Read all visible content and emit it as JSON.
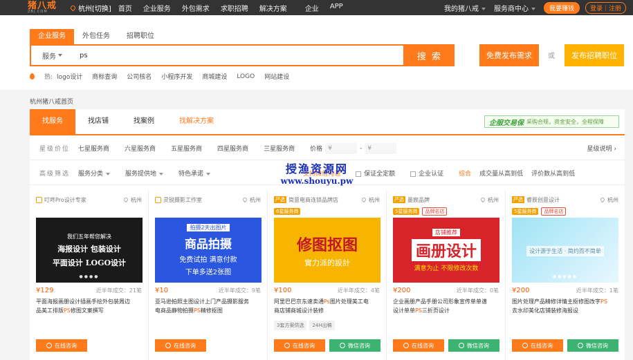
{
  "topbar": {
    "logo": "猪八戒",
    "logo_en": "ZBJ.COM",
    "city": "杭州[切换]",
    "nav": [
      "首页",
      "企业服务",
      "外包需求",
      "求职招聘",
      "解决方案",
      "企业",
      "APP"
    ],
    "my": "我的猪八戒",
    "svc": "服务商中心",
    "earn": "我要赚钱",
    "login": "登录｜注册"
  },
  "search": {
    "tabs": [
      "企业服务",
      "外包任务",
      "招聘职位"
    ],
    "type": "服务",
    "value": "ps",
    "btn": "搜 索",
    "free": "免费发布需求",
    "or": "或",
    "job": "发布招聘职位"
  },
  "hot": {
    "label": "热:",
    "items": [
      "logo设计",
      "商标查询",
      "公司核名",
      "小程序开发",
      "商城建设",
      "LOGO",
      "网站建设"
    ]
  },
  "crumb": "杭州猪八戒首页",
  "ptabs": [
    "找服务",
    "找店铺",
    "找案例",
    "找解决方案"
  ],
  "guar": {
    "name": "企服交易保",
    "desc": "采购合规，资金安全，全程保障"
  },
  "level": {
    "label": "星级价位",
    "items": [
      "七星服务商",
      "六星服务商",
      "五星服务商",
      "四星服务商",
      "三星服务商"
    ],
    "price": "价格",
    "p1": "¥",
    "p2": "¥",
    "dash": "-",
    "right": "星级说明 ›"
  },
  "filter": {
    "label": "高级筛选",
    "items": [
      "服务分类",
      "服务提供地",
      "特色承诺"
    ],
    "trial": "支持微信沟通",
    "c1": "保证全定额",
    "c2": "企业认证",
    "sort": [
      "综合",
      "成交量从高到低",
      "评价数从高到低"
    ]
  },
  "watermark": {
    "l1": "授渔资源网",
    "l2": "www.shouyu.pw"
  },
  "cards": [
    {
      "shop": "叮咚Pro设计专家",
      "badge": "",
      "loc": "杭州",
      "tag1": "",
      "tag2": "",
      "img_top": "我们五年帮您解决",
      "img_l1": "海报设计 包装设计",
      "img_l2": "平面设计 LOGO设计",
      "price": "¥129",
      "sales": "近半年成交：21笔",
      "t1": "平面海报画册设计插画手绘外包装周边",
      "t2": "品美工排版",
      "ps": "PS",
      "t3": "修图文案撰写",
      "svc": [],
      "b1": "在线咨询",
      "b2": ""
    },
    {
      "shop": "灵锐摄影工作室",
      "badge": "",
      "loc": "杭州",
      "tag1": "",
      "tag2": "",
      "img_top": "拍摄2天出图片",
      "img_l1": "商品拍摄",
      "img_l2": "免费试拍 满意付款",
      "img_l3": "下单多送2张图",
      "price": "¥10",
      "sales": "近半年成交：9笔",
      "t1": "亚马逊拍照主图设计上门产品摄影服务",
      "t2": "电商品静物拍摄",
      "ps": "PS",
      "t3": "精修抠图",
      "svc": [],
      "b1": "在线咨询",
      "b2": ""
    },
    {
      "shop": "简意电商连锁品牌店",
      "badge": "严选",
      "loc": "杭州",
      "tag1": "6星服务商",
      "tag2": "",
      "img_top": "",
      "img_l1": "修图抠图",
      "img_l2": "實力派的設計",
      "price": "¥100",
      "sales": "近半年成交：4笔",
      "t1": "阿里巴巴京东速卖通",
      "ps": "Ps",
      "t2": "图片处理美工电",
      "t3": "商店铺商城设计装修",
      "svc": [
        "3套方案供选",
        "24H出稿"
      ],
      "b1": "在线咨询",
      "b2": "微信咨询"
    },
    {
      "shop": "墨宸品牌",
      "badge": "严选",
      "loc": "杭州",
      "tag1": "5星服务商",
      "tag2": "品牌名店",
      "img_top": "店铺推荐",
      "img_l1": "画册设计",
      "img_l2": "满意为止 不限修改次数",
      "price": "¥200",
      "sales": "近半年成交：0笔",
      "t1": "企业画册产品手册公司形象宣传单单谱",
      "t2": "设计单单",
      "ps": "PS",
      "t3": "三折页设计",
      "svc": [],
      "b1": "在线咨询",
      "b2": "微信咨询"
    },
    {
      "shop": "睿辰创意设计",
      "badge": "严选",
      "loc": "杭州",
      "tag1": "5星服务商",
      "tag2": "品牌名店",
      "img_top": "",
      "img_l1": "设计源于生活 · 简约而不简单",
      "img_l2": "",
      "price": "¥200",
      "sales": "近半年成交：1笔",
      "t1": "图片处理产品精修详情主抠修图改字",
      "ps": "PS",
      "t2": "",
      "t3": "去水印美化店铺装修海报设",
      "svc": [],
      "b1": "在线咨询",
      "b2": "微信咨询"
    }
  ]
}
